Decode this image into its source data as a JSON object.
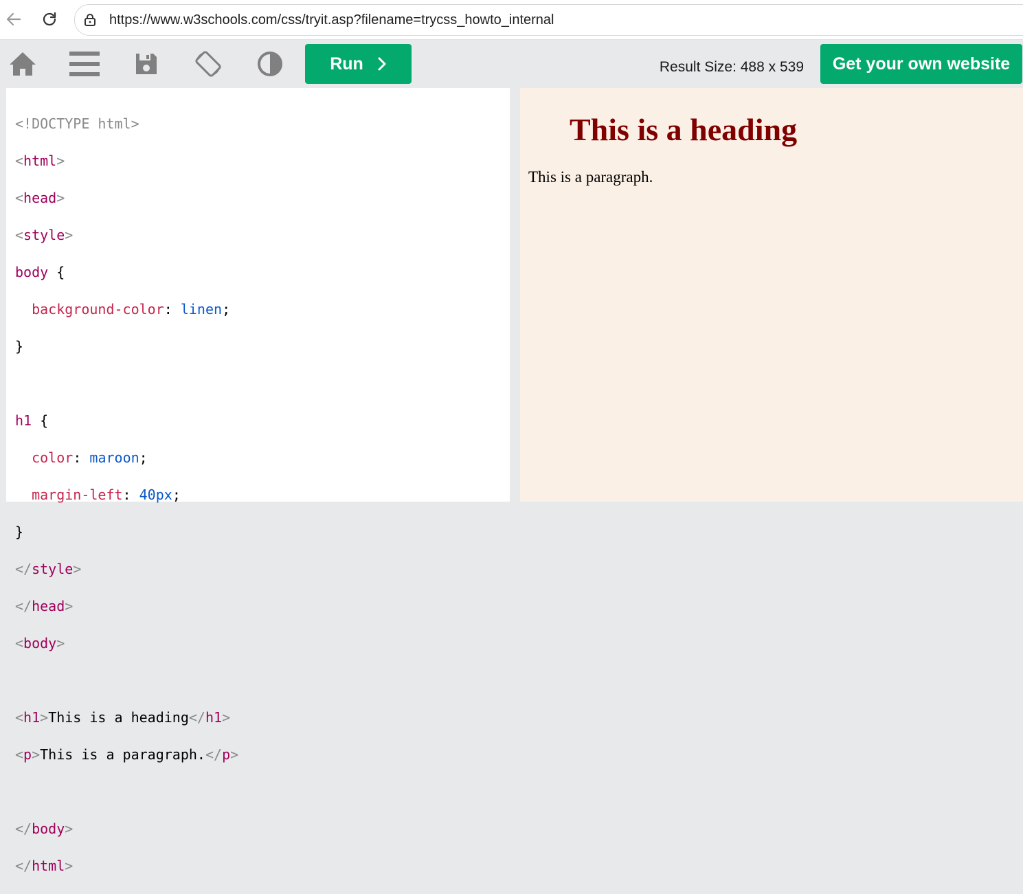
{
  "browser": {
    "url": "https://www.w3schools.com/css/tryit.asp?filename=trycss_howto_internal"
  },
  "toolbar": {
    "run_label": "Run",
    "run_icon": "chevron-right-icon",
    "result_size": "Result Size: 488 x 539",
    "get_website_label": "Get your own website",
    "icons": [
      "home-icon",
      "menu-icon",
      "save-icon",
      "rotate-icon",
      "contrast-icon"
    ],
    "accent_color": "#04aa6d"
  },
  "code": {
    "line1": "<!DOCTYPE html>",
    "html_tag": "html",
    "head_tag": "head",
    "style_tag": "style",
    "body_selector": "body",
    "prop_bg": "background-color",
    "val_bg": "linen",
    "h1_selector": "h1",
    "prop_color": "color",
    "val_color": "maroon",
    "prop_margin": "margin-left",
    "val_margin": "40px",
    "body_tag": "body",
    "h1_tag": "h1",
    "h1_text": "This is a heading",
    "p_tag": "p",
    "p_text": "This is a paragraph."
  },
  "result": {
    "heading": "This is a heading",
    "paragraph": "This is a paragraph.",
    "background_color": "#faf0e6",
    "heading_color": "#800000"
  }
}
